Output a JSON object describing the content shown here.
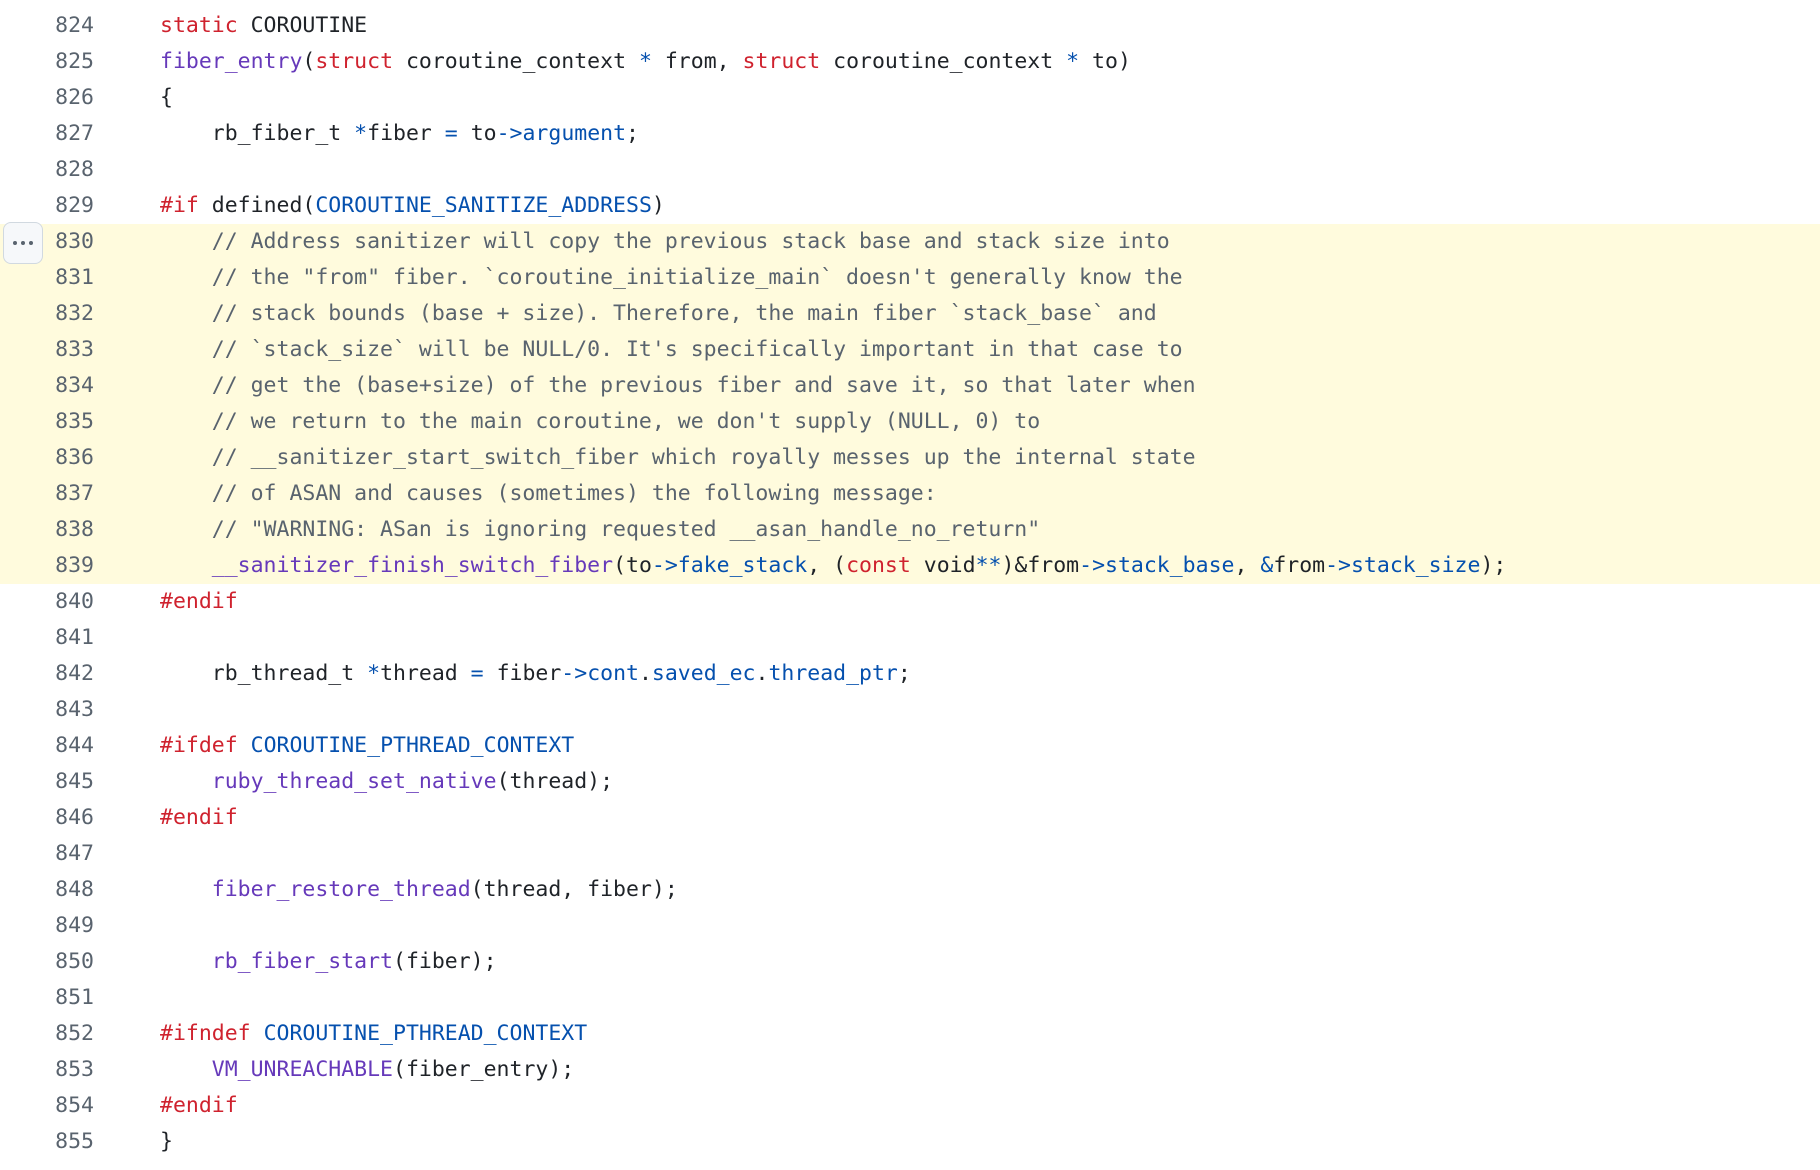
{
  "code_view": {
    "line_options_icon": "kebab-horizontal-icon",
    "highlight_color": "#fffbdd",
    "colors": {
      "keyword": "#cf222e",
      "function": "#6639ba",
      "member": "#0550ae",
      "comment": "#59636e",
      "plain": "#1f2328",
      "line_number": "#59636e"
    },
    "lines": [
      {
        "number": "824",
        "highlighted": false,
        "tokens": [
          {
            "t": "kw",
            "v": "static"
          },
          {
            "t": "pl",
            "v": " COROUTINE"
          }
        ]
      },
      {
        "number": "825",
        "highlighted": false,
        "tokens": [
          {
            "t": "fn",
            "v": "fiber_entry"
          },
          {
            "t": "pl",
            "v": "("
          },
          {
            "t": "kw",
            "v": "struct"
          },
          {
            "t": "pl",
            "v": " coroutine_context "
          },
          {
            "t": "op",
            "v": "*"
          },
          {
            "t": "pl",
            "v": " from, "
          },
          {
            "t": "kw",
            "v": "struct"
          },
          {
            "t": "pl",
            "v": " coroutine_context "
          },
          {
            "t": "op",
            "v": "*"
          },
          {
            "t": "pl",
            "v": " to)"
          }
        ]
      },
      {
        "number": "826",
        "highlighted": false,
        "tokens": [
          {
            "t": "pl",
            "v": "{"
          }
        ]
      },
      {
        "number": "827",
        "highlighted": false,
        "tokens": [
          {
            "t": "pl",
            "v": "    rb_fiber_t "
          },
          {
            "t": "op",
            "v": "*"
          },
          {
            "t": "pl",
            "v": "fiber "
          },
          {
            "t": "op",
            "v": "="
          },
          {
            "t": "pl",
            "v": " to"
          },
          {
            "t": "op",
            "v": "->"
          },
          {
            "t": "mem",
            "v": "argument"
          },
          {
            "t": "pl",
            "v": ";"
          }
        ]
      },
      {
        "number": "828",
        "highlighted": false,
        "tokens": []
      },
      {
        "number": "829",
        "highlighted": false,
        "tokens": [
          {
            "t": "kw",
            "v": "#if"
          },
          {
            "t": "pl",
            "v": " defined("
          },
          {
            "t": "mem",
            "v": "COROUTINE_SANITIZE_ADDRESS"
          },
          {
            "t": "pl",
            "v": ")"
          }
        ]
      },
      {
        "number": "830",
        "highlighted": true,
        "tokens": [
          {
            "t": "cm",
            "v": "    // Address sanitizer will copy the previous stack base and stack size into"
          }
        ]
      },
      {
        "number": "831",
        "highlighted": true,
        "tokens": [
          {
            "t": "cm",
            "v": "    // the \"from\" fiber. `coroutine_initialize_main` doesn't generally know the"
          }
        ]
      },
      {
        "number": "832",
        "highlighted": true,
        "tokens": [
          {
            "t": "cm",
            "v": "    // stack bounds (base + size). Therefore, the main fiber `stack_base` and"
          }
        ]
      },
      {
        "number": "833",
        "highlighted": true,
        "tokens": [
          {
            "t": "cm",
            "v": "    // `stack_size` will be NULL/0. It's specifically important in that case to"
          }
        ]
      },
      {
        "number": "834",
        "highlighted": true,
        "tokens": [
          {
            "t": "cm",
            "v": "    // get the (base+size) of the previous fiber and save it, so that later when"
          }
        ]
      },
      {
        "number": "835",
        "highlighted": true,
        "tokens": [
          {
            "t": "cm",
            "v": "    // we return to the main coroutine, we don't supply (NULL, 0) to"
          }
        ]
      },
      {
        "number": "836",
        "highlighted": true,
        "tokens": [
          {
            "t": "cm",
            "v": "    // __sanitizer_start_switch_fiber which royally messes up the internal state"
          }
        ]
      },
      {
        "number": "837",
        "highlighted": true,
        "tokens": [
          {
            "t": "cm",
            "v": "    // of ASAN and causes (sometimes) the following message:"
          }
        ]
      },
      {
        "number": "838",
        "highlighted": true,
        "tokens": [
          {
            "t": "cm",
            "v": "    // \"WARNING: ASan is ignoring requested __asan_handle_no_return\""
          }
        ]
      },
      {
        "number": "839",
        "highlighted": true,
        "tokens": [
          {
            "t": "pl",
            "v": "    "
          },
          {
            "t": "fn",
            "v": "__sanitizer_finish_switch_fiber"
          },
          {
            "t": "pl",
            "v": "(to"
          },
          {
            "t": "op",
            "v": "->"
          },
          {
            "t": "mem",
            "v": "fake_stack"
          },
          {
            "t": "pl",
            "v": ", ("
          },
          {
            "t": "kw",
            "v": "const"
          },
          {
            "t": "pl",
            "v": " void"
          },
          {
            "t": "op",
            "v": "**"
          },
          {
            "t": "pl",
            "v": ")&from"
          },
          {
            "t": "op",
            "v": "->"
          },
          {
            "t": "mem",
            "v": "stack_base"
          },
          {
            "t": "pl",
            "v": ", "
          },
          {
            "t": "op",
            "v": "&"
          },
          {
            "t": "pl",
            "v": "from"
          },
          {
            "t": "op",
            "v": "->"
          },
          {
            "t": "mem",
            "v": "stack_size"
          },
          {
            "t": "pl",
            "v": ");"
          }
        ]
      },
      {
        "number": "840",
        "highlighted": false,
        "tokens": [
          {
            "t": "kw",
            "v": "#endif"
          }
        ]
      },
      {
        "number": "841",
        "highlighted": false,
        "tokens": []
      },
      {
        "number": "842",
        "highlighted": false,
        "tokens": [
          {
            "t": "pl",
            "v": "    rb_thread_t "
          },
          {
            "t": "op",
            "v": "*"
          },
          {
            "t": "pl",
            "v": "thread "
          },
          {
            "t": "op",
            "v": "="
          },
          {
            "t": "pl",
            "v": " fiber"
          },
          {
            "t": "op",
            "v": "->"
          },
          {
            "t": "mem",
            "v": "cont"
          },
          {
            "t": "pl",
            "v": "."
          },
          {
            "t": "mem",
            "v": "saved_ec"
          },
          {
            "t": "pl",
            "v": "."
          },
          {
            "t": "mem",
            "v": "thread_ptr"
          },
          {
            "t": "pl",
            "v": ";"
          }
        ]
      },
      {
        "number": "843",
        "highlighted": false,
        "tokens": []
      },
      {
        "number": "844",
        "highlighted": false,
        "tokens": [
          {
            "t": "kw",
            "v": "#ifdef"
          },
          {
            "t": "pl",
            "v": " "
          },
          {
            "t": "mem",
            "v": "COROUTINE_PTHREAD_CONTEXT"
          }
        ]
      },
      {
        "number": "845",
        "highlighted": false,
        "tokens": [
          {
            "t": "pl",
            "v": "    "
          },
          {
            "t": "fn",
            "v": "ruby_thread_set_native"
          },
          {
            "t": "pl",
            "v": "(thread);"
          }
        ]
      },
      {
        "number": "846",
        "highlighted": false,
        "tokens": [
          {
            "t": "kw",
            "v": "#endif"
          }
        ]
      },
      {
        "number": "847",
        "highlighted": false,
        "tokens": []
      },
      {
        "number": "848",
        "highlighted": false,
        "tokens": [
          {
            "t": "pl",
            "v": "    "
          },
          {
            "t": "fn",
            "v": "fiber_restore_thread"
          },
          {
            "t": "pl",
            "v": "(thread, fiber);"
          }
        ]
      },
      {
        "number": "849",
        "highlighted": false,
        "tokens": []
      },
      {
        "number": "850",
        "highlighted": false,
        "tokens": [
          {
            "t": "pl",
            "v": "    "
          },
          {
            "t": "fn",
            "v": "rb_fiber_start"
          },
          {
            "t": "pl",
            "v": "(fiber);"
          }
        ]
      },
      {
        "number": "851",
        "highlighted": false,
        "tokens": []
      },
      {
        "number": "852",
        "highlighted": false,
        "tokens": [
          {
            "t": "kw",
            "v": "#ifndef"
          },
          {
            "t": "pl",
            "v": " "
          },
          {
            "t": "mem",
            "v": "COROUTINE_PTHREAD_CONTEXT"
          }
        ]
      },
      {
        "number": "853",
        "highlighted": false,
        "tokens": [
          {
            "t": "pl",
            "v": "    "
          },
          {
            "t": "fn",
            "v": "VM_UNREACHABLE"
          },
          {
            "t": "pl",
            "v": "(fiber_entry);"
          }
        ]
      },
      {
        "number": "854",
        "highlighted": false,
        "tokens": [
          {
            "t": "kw",
            "v": "#endif"
          }
        ]
      },
      {
        "number": "855",
        "highlighted": false,
        "tokens": [
          {
            "t": "pl",
            "v": "}"
          }
        ]
      }
    ]
  }
}
